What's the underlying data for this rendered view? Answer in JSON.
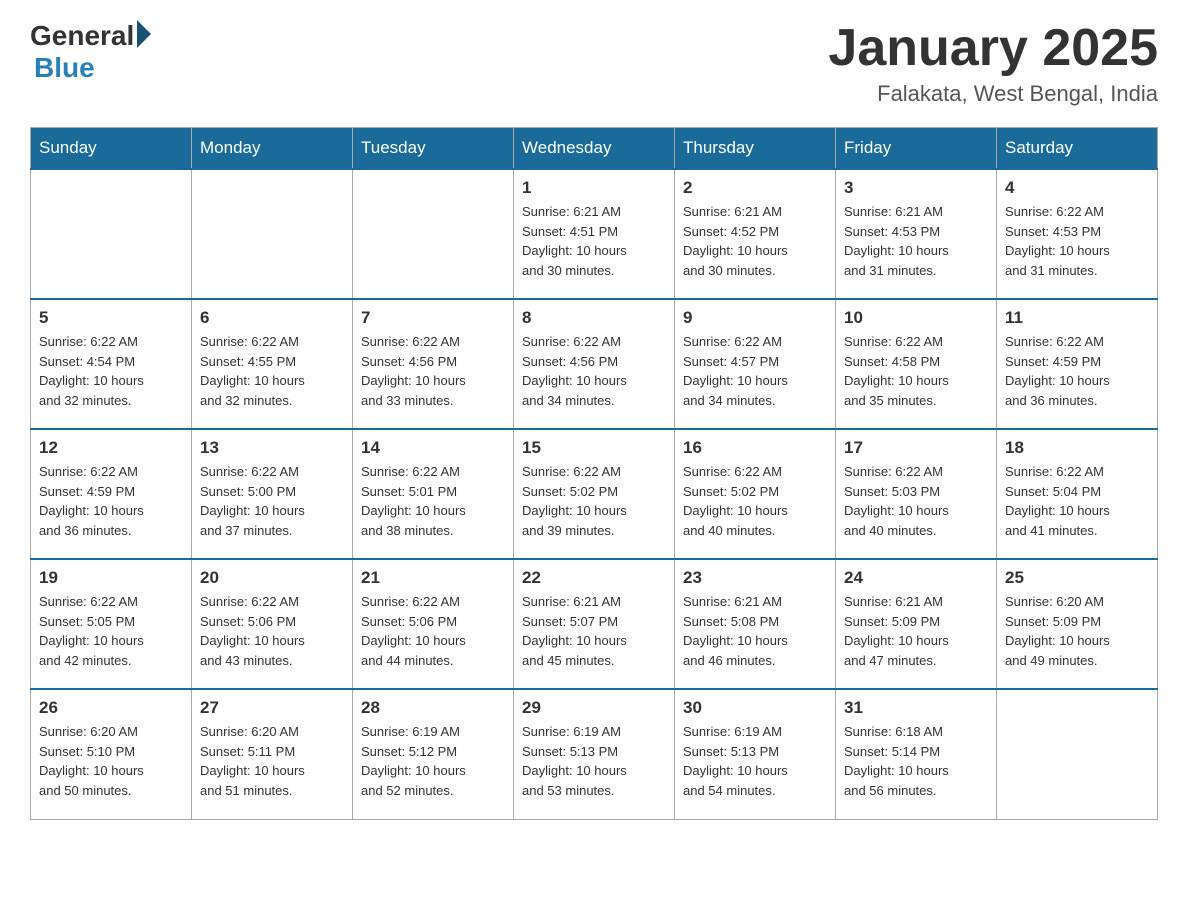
{
  "header": {
    "logo_general": "General",
    "logo_blue": "Blue",
    "month_title": "January 2025",
    "location": "Falakata, West Bengal, India"
  },
  "days_of_week": [
    "Sunday",
    "Monday",
    "Tuesday",
    "Wednesday",
    "Thursday",
    "Friday",
    "Saturday"
  ],
  "weeks": [
    [
      {
        "day": "",
        "info": ""
      },
      {
        "day": "",
        "info": ""
      },
      {
        "day": "",
        "info": ""
      },
      {
        "day": "1",
        "info": "Sunrise: 6:21 AM\nSunset: 4:51 PM\nDaylight: 10 hours\nand 30 minutes."
      },
      {
        "day": "2",
        "info": "Sunrise: 6:21 AM\nSunset: 4:52 PM\nDaylight: 10 hours\nand 30 minutes."
      },
      {
        "day": "3",
        "info": "Sunrise: 6:21 AM\nSunset: 4:53 PM\nDaylight: 10 hours\nand 31 minutes."
      },
      {
        "day": "4",
        "info": "Sunrise: 6:22 AM\nSunset: 4:53 PM\nDaylight: 10 hours\nand 31 minutes."
      }
    ],
    [
      {
        "day": "5",
        "info": "Sunrise: 6:22 AM\nSunset: 4:54 PM\nDaylight: 10 hours\nand 32 minutes."
      },
      {
        "day": "6",
        "info": "Sunrise: 6:22 AM\nSunset: 4:55 PM\nDaylight: 10 hours\nand 32 minutes."
      },
      {
        "day": "7",
        "info": "Sunrise: 6:22 AM\nSunset: 4:56 PM\nDaylight: 10 hours\nand 33 minutes."
      },
      {
        "day": "8",
        "info": "Sunrise: 6:22 AM\nSunset: 4:56 PM\nDaylight: 10 hours\nand 34 minutes."
      },
      {
        "day": "9",
        "info": "Sunrise: 6:22 AM\nSunset: 4:57 PM\nDaylight: 10 hours\nand 34 minutes."
      },
      {
        "day": "10",
        "info": "Sunrise: 6:22 AM\nSunset: 4:58 PM\nDaylight: 10 hours\nand 35 minutes."
      },
      {
        "day": "11",
        "info": "Sunrise: 6:22 AM\nSunset: 4:59 PM\nDaylight: 10 hours\nand 36 minutes."
      }
    ],
    [
      {
        "day": "12",
        "info": "Sunrise: 6:22 AM\nSunset: 4:59 PM\nDaylight: 10 hours\nand 36 minutes."
      },
      {
        "day": "13",
        "info": "Sunrise: 6:22 AM\nSunset: 5:00 PM\nDaylight: 10 hours\nand 37 minutes."
      },
      {
        "day": "14",
        "info": "Sunrise: 6:22 AM\nSunset: 5:01 PM\nDaylight: 10 hours\nand 38 minutes."
      },
      {
        "day": "15",
        "info": "Sunrise: 6:22 AM\nSunset: 5:02 PM\nDaylight: 10 hours\nand 39 minutes."
      },
      {
        "day": "16",
        "info": "Sunrise: 6:22 AM\nSunset: 5:02 PM\nDaylight: 10 hours\nand 40 minutes."
      },
      {
        "day": "17",
        "info": "Sunrise: 6:22 AM\nSunset: 5:03 PM\nDaylight: 10 hours\nand 40 minutes."
      },
      {
        "day": "18",
        "info": "Sunrise: 6:22 AM\nSunset: 5:04 PM\nDaylight: 10 hours\nand 41 minutes."
      }
    ],
    [
      {
        "day": "19",
        "info": "Sunrise: 6:22 AM\nSunset: 5:05 PM\nDaylight: 10 hours\nand 42 minutes."
      },
      {
        "day": "20",
        "info": "Sunrise: 6:22 AM\nSunset: 5:06 PM\nDaylight: 10 hours\nand 43 minutes."
      },
      {
        "day": "21",
        "info": "Sunrise: 6:22 AM\nSunset: 5:06 PM\nDaylight: 10 hours\nand 44 minutes."
      },
      {
        "day": "22",
        "info": "Sunrise: 6:21 AM\nSunset: 5:07 PM\nDaylight: 10 hours\nand 45 minutes."
      },
      {
        "day": "23",
        "info": "Sunrise: 6:21 AM\nSunset: 5:08 PM\nDaylight: 10 hours\nand 46 minutes."
      },
      {
        "day": "24",
        "info": "Sunrise: 6:21 AM\nSunset: 5:09 PM\nDaylight: 10 hours\nand 47 minutes."
      },
      {
        "day": "25",
        "info": "Sunrise: 6:20 AM\nSunset: 5:09 PM\nDaylight: 10 hours\nand 49 minutes."
      }
    ],
    [
      {
        "day": "26",
        "info": "Sunrise: 6:20 AM\nSunset: 5:10 PM\nDaylight: 10 hours\nand 50 minutes."
      },
      {
        "day": "27",
        "info": "Sunrise: 6:20 AM\nSunset: 5:11 PM\nDaylight: 10 hours\nand 51 minutes."
      },
      {
        "day": "28",
        "info": "Sunrise: 6:19 AM\nSunset: 5:12 PM\nDaylight: 10 hours\nand 52 minutes."
      },
      {
        "day": "29",
        "info": "Sunrise: 6:19 AM\nSunset: 5:13 PM\nDaylight: 10 hours\nand 53 minutes."
      },
      {
        "day": "30",
        "info": "Sunrise: 6:19 AM\nSunset: 5:13 PM\nDaylight: 10 hours\nand 54 minutes."
      },
      {
        "day": "31",
        "info": "Sunrise: 6:18 AM\nSunset: 5:14 PM\nDaylight: 10 hours\nand 56 minutes."
      },
      {
        "day": "",
        "info": ""
      }
    ]
  ]
}
